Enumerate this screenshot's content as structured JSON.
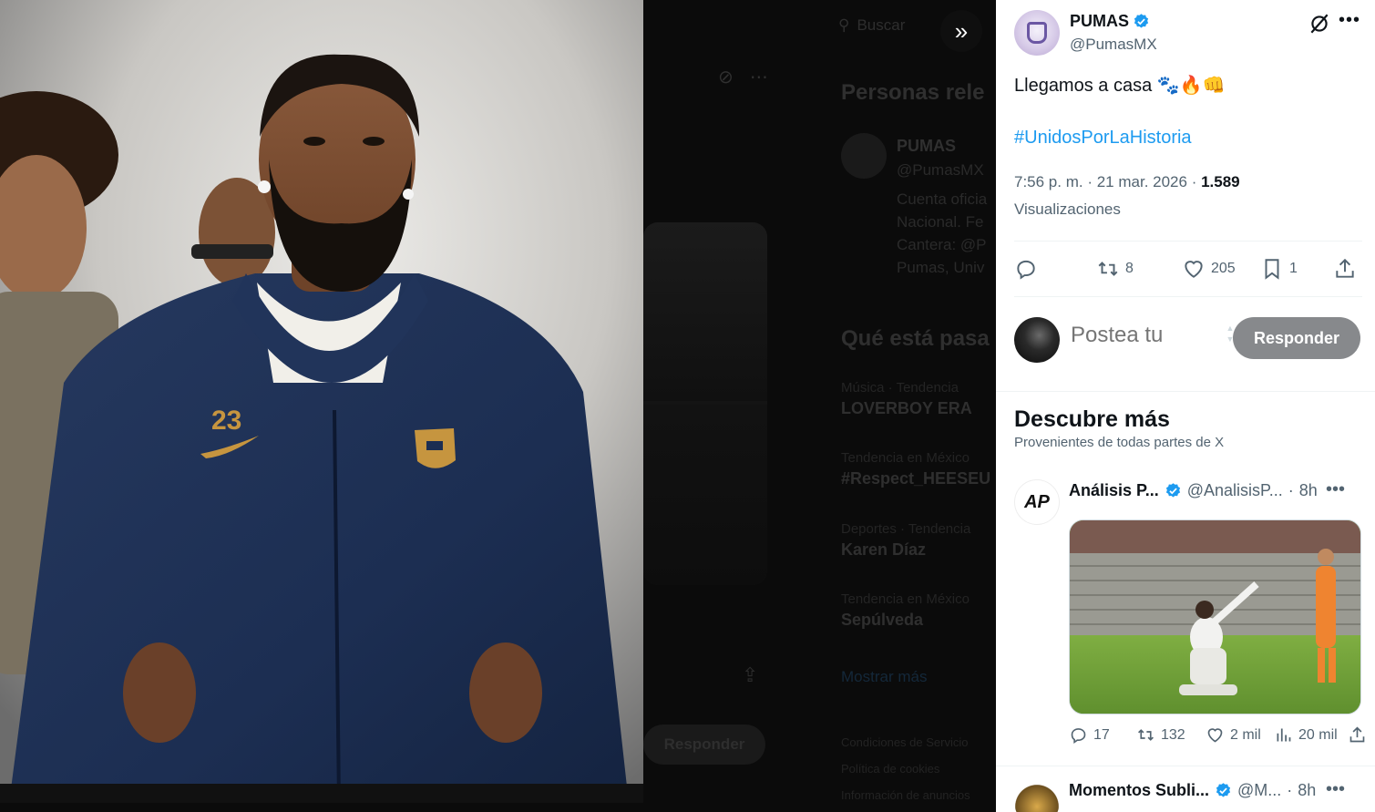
{
  "background_page": {
    "search_placeholder": "Buscar",
    "people_title": "Personas rele",
    "profile_name": "PUMAS",
    "profile_handle": "@PumasMX",
    "bio_lines": [
      "Cuenta oficia",
      "Nacional. Fe",
      "Cantera: @P",
      "Pumas, Univ"
    ],
    "trends_title": "Qué está pasa",
    "trends": [
      {
        "context": "Música · Tendencia",
        "name": "LOVERBOY ERA"
      },
      {
        "context": "Tendencia en México",
        "name": "#Respect_HEESEU"
      },
      {
        "context": "Deportes · Tendencia",
        "name": "Karen Díaz"
      },
      {
        "context": "Tendencia en México",
        "name": "Sepúlveda"
      }
    ],
    "show_more": "Mostrar más",
    "footer": [
      "Condiciones de Servicio",
      "Política de cookies",
      "Información de anuncios"
    ],
    "reply_button": "Responder"
  },
  "photo": {
    "jersey_number": "23",
    "dots": "•••"
  },
  "post": {
    "author_name": "PUMAS",
    "author_handle": "@PumasMX",
    "text": "Llegamos a casa 🐾🔥👊",
    "hashtag": "#UnidosPorLaHistoria",
    "time": "7:56 p. m.",
    "date": "21 mar. 2026",
    "views_count": "1.589",
    "views_label": "Visualizaciones",
    "reposts": "8",
    "likes": "205",
    "bookmarks": "1"
  },
  "reply": {
    "placeholder": "Postea tu",
    "button": "Responder"
  },
  "discover": {
    "title": "Descubre más",
    "subtitle": "Provenientes de todas partes de X",
    "items": [
      {
        "name": "Análisis P...",
        "handle": "@AnalisisP...",
        "time": "8h",
        "avatar_text": "AP",
        "replies": "17",
        "reposts": "132",
        "likes": "2 mil",
        "views": "20 mil"
      },
      {
        "name": "Momentos Subli...",
        "handle": "@M...",
        "time": "8h"
      }
    ]
  },
  "colors": {
    "accent": "#1d9bf0",
    "verified": "#1d9bf0",
    "reply_button_bg": "#87898c",
    "panel_bg": "#ffffff",
    "jacket": "#1c2e52"
  },
  "icons": [
    "expand-chevrons-icon",
    "grok-icon",
    "more-icon",
    "reply-icon",
    "repost-icon",
    "like-icon",
    "bookmark-icon",
    "share-icon",
    "views-icon",
    "verified-badge-icon",
    "search-icon"
  ]
}
